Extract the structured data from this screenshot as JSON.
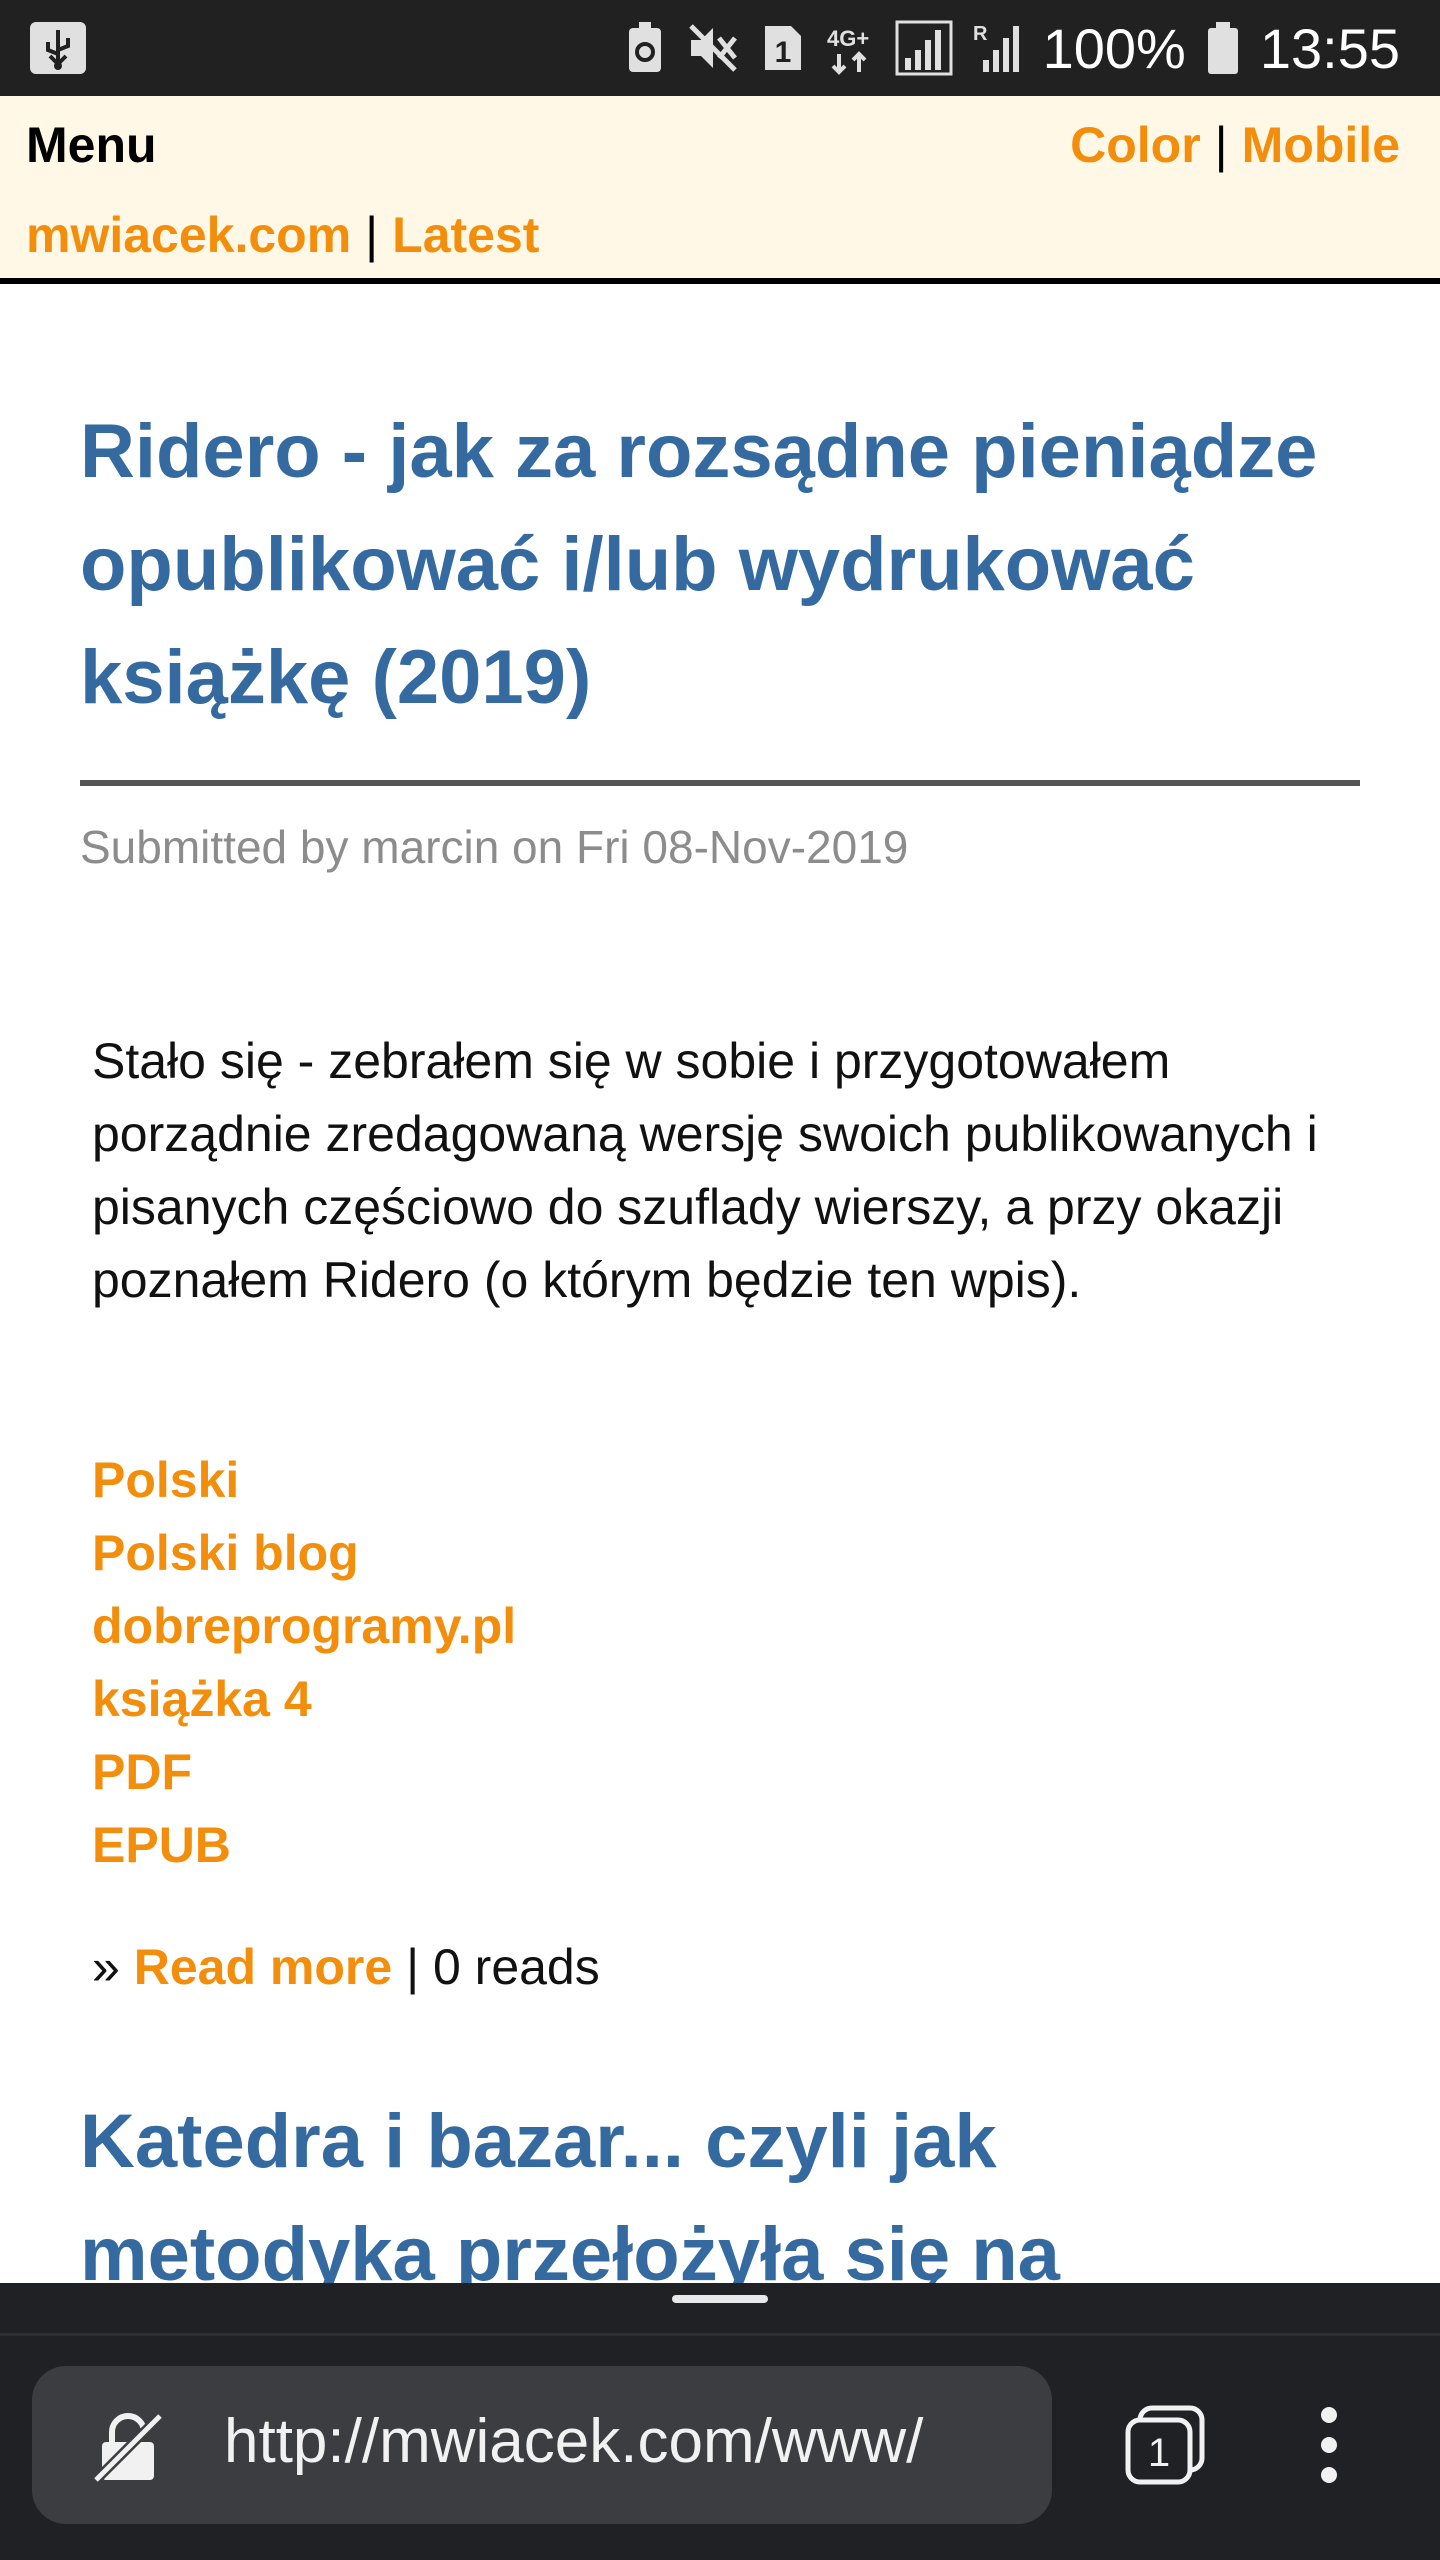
{
  "status_bar": {
    "battery": "100%",
    "time": "13:55",
    "sim_slot": "1",
    "network": "4G+",
    "roaming": "R"
  },
  "header": {
    "menu_label": "Menu",
    "color_link": "Color",
    "mobile_link": "Mobile",
    "site_link": "mwiacek.com",
    "latest_link": "Latest",
    "separator": "|"
  },
  "article": {
    "title": "Ridero - jak za rozsądne pieniądze opublikować i/lub wydrukować książkę (2019)",
    "submitted": "Submitted by marcin on Fri 08-Nov-2019",
    "summary": "Stało się - zebrałem się w sobie i przygotowałem porządnie zredagowaną wersję swoich publikowanych i pisanych częściowo do szuflady wierszy, a przy okazji poznałem Ridero (o którym będzie ten wpis).",
    "tags": [
      "Polski",
      "Polski blog",
      "dobreprogramy.pl",
      "książka 4",
      "PDF",
      "EPUB"
    ],
    "read_prefix": "»",
    "read_more": "Read more",
    "separator": "|",
    "reads": "0 reads"
  },
  "next_article": {
    "title": "Katedra i bazar... czyli jak metodyka przełożyła się na"
  },
  "browser": {
    "url": "http://mwiacek.com/www/",
    "tab_count": "1"
  },
  "colors": {
    "link_orange": "#f28e0b",
    "title_blue": "#346a9f",
    "header_bg": "#fff8e7",
    "browser_bar": "#202124"
  }
}
